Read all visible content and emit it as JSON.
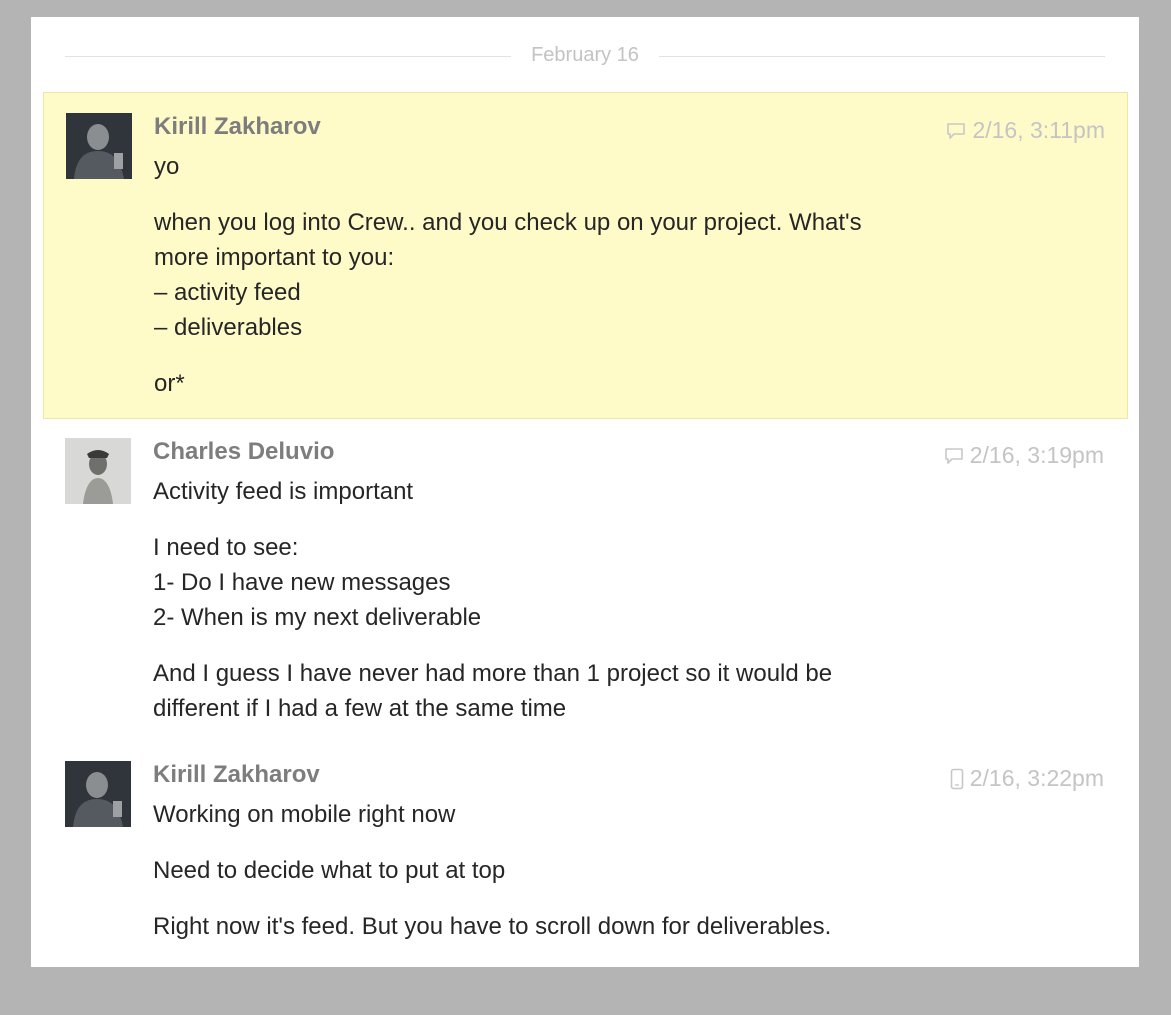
{
  "date_divider": "February 16",
  "messages": [
    {
      "author": "Kirill Zakharov",
      "timestamp": "2/16, 3:11pm",
      "source_icon": "chat-bubble-icon",
      "highlighted": true,
      "paragraphs": [
        [
          "yo"
        ],
        [
          "when you log into Crew.. and you check up on your project. What's",
          "more important to you:",
          "– activity feed",
          "– deliverables"
        ],
        [
          "or*"
        ]
      ]
    },
    {
      "author": "Charles Deluvio",
      "timestamp": "2/16, 3:19pm",
      "source_icon": "chat-bubble-icon",
      "highlighted": false,
      "paragraphs": [
        [
          "Activity feed is important"
        ],
        [
          "I need to see:",
          "1- Do I have new messages",
          "2- When is my next deliverable"
        ],
        [
          "And I guess I have never had more than 1 project so it would be",
          "different if I had a few at the same time"
        ]
      ]
    },
    {
      "author": "Kirill Zakharov",
      "timestamp": "2/16, 3:22pm",
      "source_icon": "mobile-phone-icon",
      "highlighted": false,
      "paragraphs": [
        [
          "Working on mobile right now"
        ],
        [
          "Need to decide what to put at top"
        ],
        [
          "Right now it's feed. But you have to scroll down for deliverables."
        ]
      ]
    }
  ],
  "colors": {
    "page_background": "#b4b4b4",
    "panel_background": "#ffffff",
    "highlight_background": "#fffbc9",
    "highlight_border": "#ede7a7",
    "author_text": "#7d7d7d",
    "timestamp_text": "#c4c4c4",
    "body_text": "#262626"
  }
}
